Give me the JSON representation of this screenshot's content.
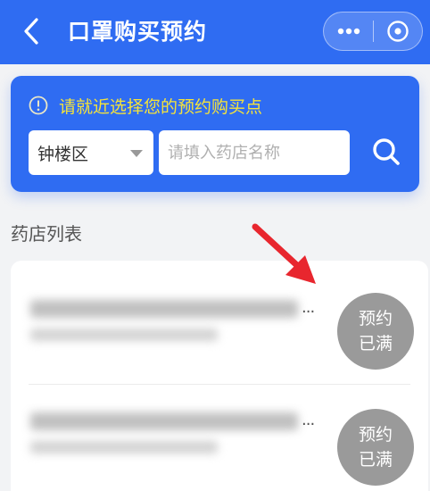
{
  "header": {
    "title": "口罩购买预约",
    "back_icon": "chevron-left-icon",
    "more_icon": "more-dots-icon",
    "close_icon": "close-circle-icon"
  },
  "search": {
    "notice_text": "请就近选择您的预约购买点",
    "notice_icon": "info-circle-icon",
    "district_value": "钟楼区",
    "store_placeholder": "请填入药店名称",
    "search_icon": "search-icon"
  },
  "list": {
    "title": "药店列表",
    "items": [
      {
        "ellipsis": "...",
        "status_line1": "预约",
        "status_line2": "已满"
      },
      {
        "ellipsis": "...",
        "status_line1": "预约",
        "status_line2": "已满"
      }
    ]
  },
  "colors": {
    "brand_blue": "#2f6cf2",
    "notice_yellow": "#f5e33a",
    "full_badge_gray": "#9a9a9a",
    "arrow_red": "#e8262e"
  }
}
